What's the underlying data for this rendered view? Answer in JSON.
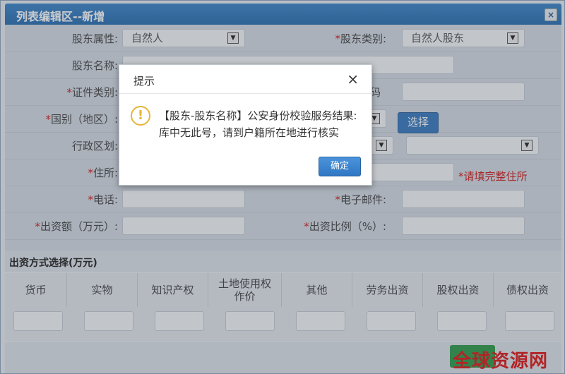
{
  "window": {
    "title": "列表编辑区--新增",
    "close": "×"
  },
  "form": {
    "shareholder_attr": {
      "label": "股东属性:",
      "value": "自然人"
    },
    "shareholder_type": {
      "required": "*",
      "label": "股东类别:",
      "value": "自然人股东"
    },
    "shareholder_name": {
      "label": "股东名称:"
    },
    "id_type": {
      "required": "*",
      "label": "证件类别:"
    },
    "id_number_tail": "码",
    "country": {
      "required": "*",
      "label": "国别（地区）:"
    },
    "choose_button": "选择",
    "admin_region": {
      "label": "行政区划:"
    },
    "address": {
      "required": "*",
      "label": "住所:",
      "hint": "*请填完整住所"
    },
    "phone": {
      "required": "*",
      "label": "电话:"
    },
    "email": {
      "required": "*",
      "label": "电子邮件:"
    },
    "capital": {
      "required": "*",
      "label": "出资额（万元）:"
    },
    "ratio": {
      "required": "*",
      "label": "出资比例（%）:"
    }
  },
  "contribution": {
    "section_title": "出资方式选择(万元)",
    "columns": [
      "货币",
      "实物",
      "知识产权",
      "土地使用权作价",
      "其他",
      "劳务出资",
      "股权出资",
      "债权出资"
    ]
  },
  "dialog": {
    "title": "提示",
    "close": "×",
    "message": "【股东-股东名称】公安身份校验服务结果:库中无此号，请到户籍所在地进行核实",
    "ok": "确定"
  },
  "watermark": "全球资源网",
  "colors": {
    "title_bar": "#2a6fb2",
    "required": "#d02020",
    "button": "#3a7bc0",
    "warning": "#e6b53a"
  }
}
